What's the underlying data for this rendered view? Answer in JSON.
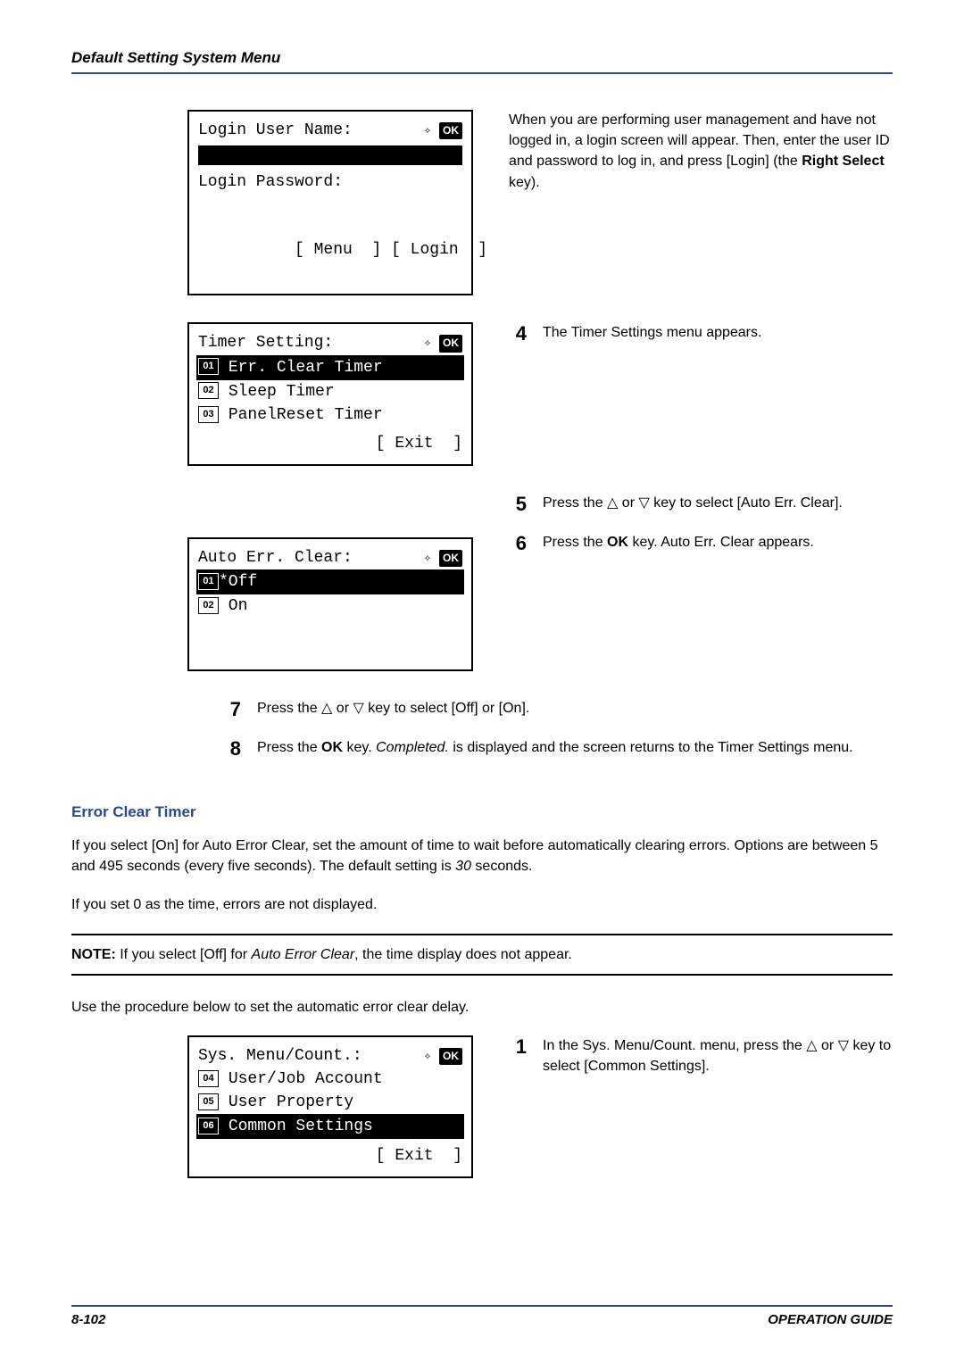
{
  "header": "Default Setting System Menu",
  "footer": {
    "left": "8-102",
    "right": "OPERATION GUIDE"
  },
  "panels": {
    "login": {
      "title": "Login User Name:",
      "password_label": "Login Password:",
      "softkeys": "[ Menu  ] [ Login  ]"
    },
    "timer": {
      "title": "Timer Setting:",
      "items": [
        {
          "num": "01",
          "label": "Err. Clear Timer",
          "selected": true
        },
        {
          "num": "02",
          "label": "Sleep Timer",
          "selected": false
        },
        {
          "num": "03",
          "label": "PanelReset Timer",
          "selected": false
        }
      ],
      "softkey": "[ Exit  ]"
    },
    "autoerr": {
      "title": "Auto Err. Clear:",
      "items": [
        {
          "num": "01",
          "label": "*Off",
          "selected": true
        },
        {
          "num": "02",
          "label": " On",
          "selected": false
        }
      ]
    },
    "sysmenu": {
      "title": "Sys. Menu/Count.:",
      "items": [
        {
          "num": "04",
          "label": "User/Job Account",
          "selected": false
        },
        {
          "num": "05",
          "label": "User Property",
          "selected": false
        },
        {
          "num": "06",
          "label": "Common Settings",
          "selected": true
        }
      ],
      "softkey": "[ Exit  ]"
    }
  },
  "steps": {
    "intro": "When you are performing user management and have not logged in, a login screen will appear. Then, enter the user ID and password to log in, and press [Login] (the ",
    "intro_bold": "Right Select",
    "intro_end": " key).",
    "s4": "The Timer Settings menu appears.",
    "s5_a": "Press the ",
    "s5_b": " or ",
    "s5_c": " key to select [Auto Err. Clear].",
    "s6_a": "Press the ",
    "s6_b": "OK",
    "s6_c": " key. Auto Err. Clear appears.",
    "s7_a": "Press the ",
    "s7_b": " or ",
    "s7_c": " key to select [Off] or [On].",
    "s8_a": "Press the ",
    "s8_b": "OK",
    "s8_c": " key. ",
    "s8_d": "Completed.",
    "s8_e": " is displayed and the screen returns to the Timer Settings menu."
  },
  "subhead": "Error Clear Timer",
  "para1_a": "If you select [On] for Auto Error Clear, set the amount of time to wait before automatically clearing errors. Options are between 5 and 495 seconds (every five seconds). The default setting is ",
  "para1_b": "30",
  "para1_c": " seconds.",
  "para2": "If you set 0 as the time, errors are not displayed.",
  "note_a": "NOTE:",
  "note_b": " If you select [Off] for ",
  "note_c": "Auto Error Clear",
  "note_d": ", the time display does not appear.",
  "para3": "Use the procedure below to set the automatic error clear delay.",
  "step1_a": "In the Sys. Menu/Count. menu, press the ",
  "step1_b": " or ",
  "step1_c": " key to select [Common Settings]."
}
